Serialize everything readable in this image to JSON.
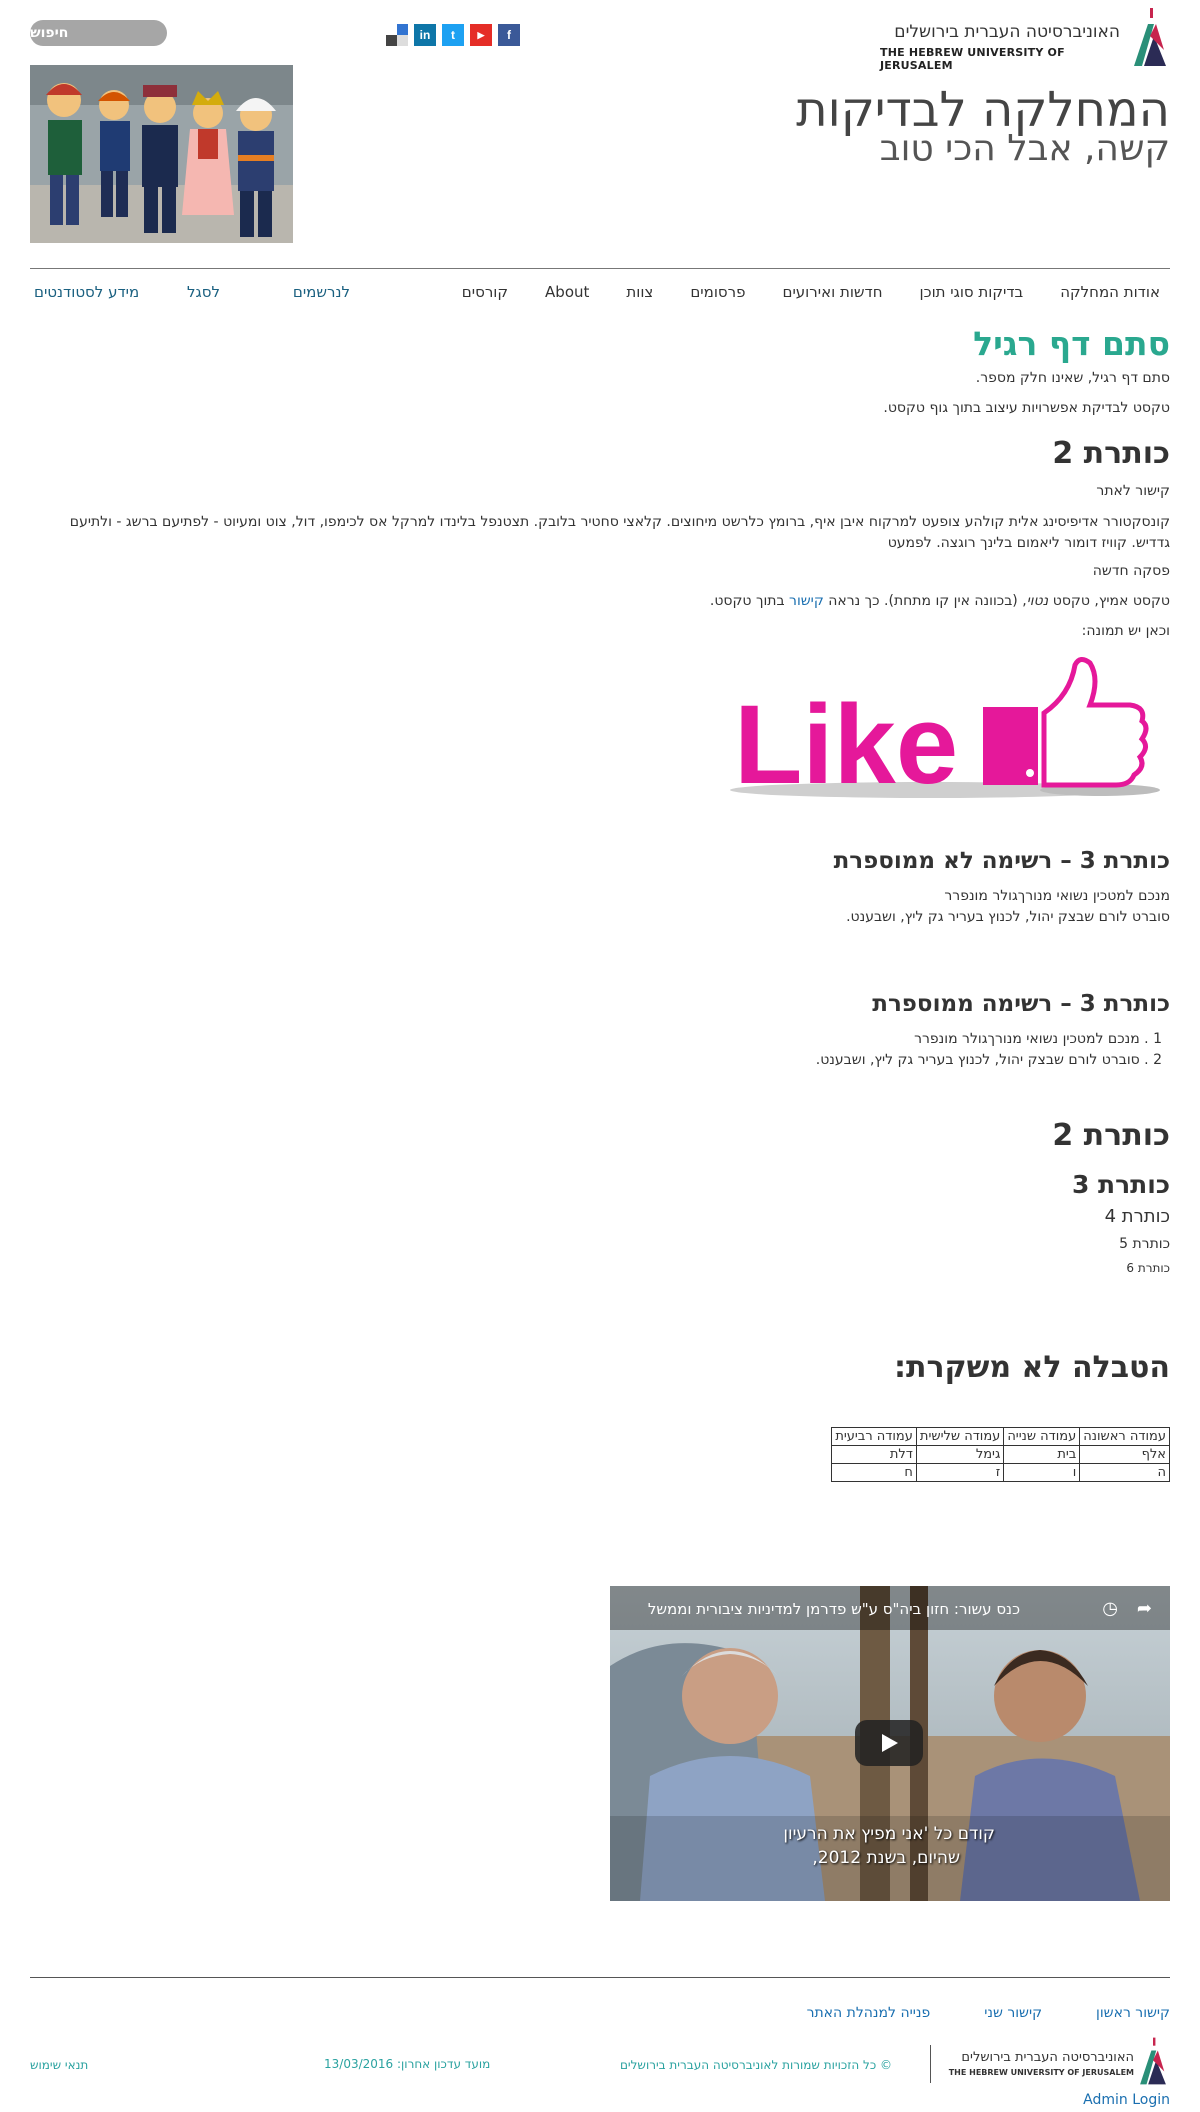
{
  "header": {
    "logo_he": "האוניברסיטה העברית בירושלים",
    "logo_en": "THE HEBREW UNIVERSITY OF JERUSALEM",
    "search_label": "חיפוש",
    "site_title": "המחלקה לבדיקות",
    "site_slogan": "קשה, אבל הכי טוב",
    "social": [
      {
        "icon": "facebook-icon",
        "glyph": "f",
        "color": "#3b5998"
      },
      {
        "icon": "youtube-icon",
        "glyph": "▶",
        "color": "#e52d27"
      },
      {
        "icon": "twitter-icon",
        "glyph": "t",
        "color": "#1da1f2"
      },
      {
        "icon": "linkedin-icon",
        "glyph": "in",
        "color": "#0e76a8"
      },
      {
        "icon": "delicious-icon",
        "glyph": "",
        "color": "#3274d1"
      }
    ]
  },
  "main_menu": [
    "אודות המחלקה",
    "בדיקות סוגי תוכן",
    "חדשות ואירועים",
    "פרסומים",
    "צוות",
    "About",
    "קורסים"
  ],
  "secondary_menu": [
    "לנרשמים",
    "לסגל",
    "מידע לסטודנטים"
  ],
  "content": {
    "page_title": "סתם דף רגיל",
    "intro_1": "סתם דף רגיל, שאינו חלק מספר.",
    "intro_2": "טקסט לבדיקת אפשרויות עיצוב בתוך גוף טקסט.",
    "h2_first": "כותרת 2",
    "site_link": "קישור לאתר",
    "lorem": "קונסקטורר אדיפיסינג אלית קולהע צופעט למרקוח איבן איף, ברומץ כלרשט מיחוצים. קלאצי סחטיר בלובק. תצטנפל בלינדו למרקל אס לכימפו, דול, צוט ומעיוט - לפתיעם ברשג - ולתיעם גדדיש. קוויז דומור ליאמום בלינך רוגצה. לפמעט",
    "new_paragraph": "פסקה חדשה",
    "styled_prefix": "טקסט אמיץ, טקסט ",
    "styled_italic": "נטוי",
    "styled_mid": ", (בכוונה אין קו מתחת). כך נראה ",
    "styled_link": "קישור",
    "styled_suffix": " בתוך טקסט.",
    "image_caption": "וכאן יש תמונה:",
    "like_text": "Like",
    "h3_unordered": "כותרת 3 – רשימה לא ממוספרת",
    "unordered": [
      "מנכם למטכין נשואי מנורךגולר מונפרר",
      "סוברט לורם שבצק יהול, לכנוץ בעריר גק ליץ, ושבענט."
    ],
    "h3_ordered": "כותרת 3 – רשימה ממוספרת",
    "ordered": [
      "1 . מנכם למטכין נשואי מנורךגולר מונפרר",
      "2 . סוברט לורם שבצק יהול, לכנוץ בעריר גק ליץ, ושבענט."
    ],
    "h2": "כותרת 2",
    "h3": "כותרת 3",
    "h4": "כותרת 4",
    "h5": "כותרת 5",
    "h6": "כותרת 6",
    "table_title": "הטבלה לא משקרת:",
    "table": {
      "headers": [
        "עמודה ראשונה",
        "עמודה שנייה",
        "עמודה שלישית",
        "עמודה רביעית"
      ],
      "rows": [
        [
          "אלף",
          "בית",
          "גימל",
          "דלת"
        ],
        [
          "ה",
          "ו",
          "ז",
          "ח"
        ]
      ]
    },
    "video": {
      "title": "כנס עשור: חזון ביה\"ס ע\"ש פדרמן למדיניות ציבורית וממשל",
      "subtitle_1": "קודם כל 'אני מפיץ את הרעיון",
      "subtitle_2": "שהיום, בשנת 2012,"
    }
  },
  "footer": {
    "links": [
      "קישור ראשון",
      "קישור שני",
      "פנייה למנהלת האתר"
    ],
    "copyright": "© כל הזכויות שמורות לאוניברסיטה העברית בירושלים",
    "updated": "מועד עדכון אחרון: 13/03/2016",
    "terms": "תנאי שימוש",
    "admin": "Admin Login",
    "logo_he": "האוניברסיטה העברית בירושלים",
    "logo_en": "THE HEBREW UNIVERSITY OF JERUSALEM"
  }
}
